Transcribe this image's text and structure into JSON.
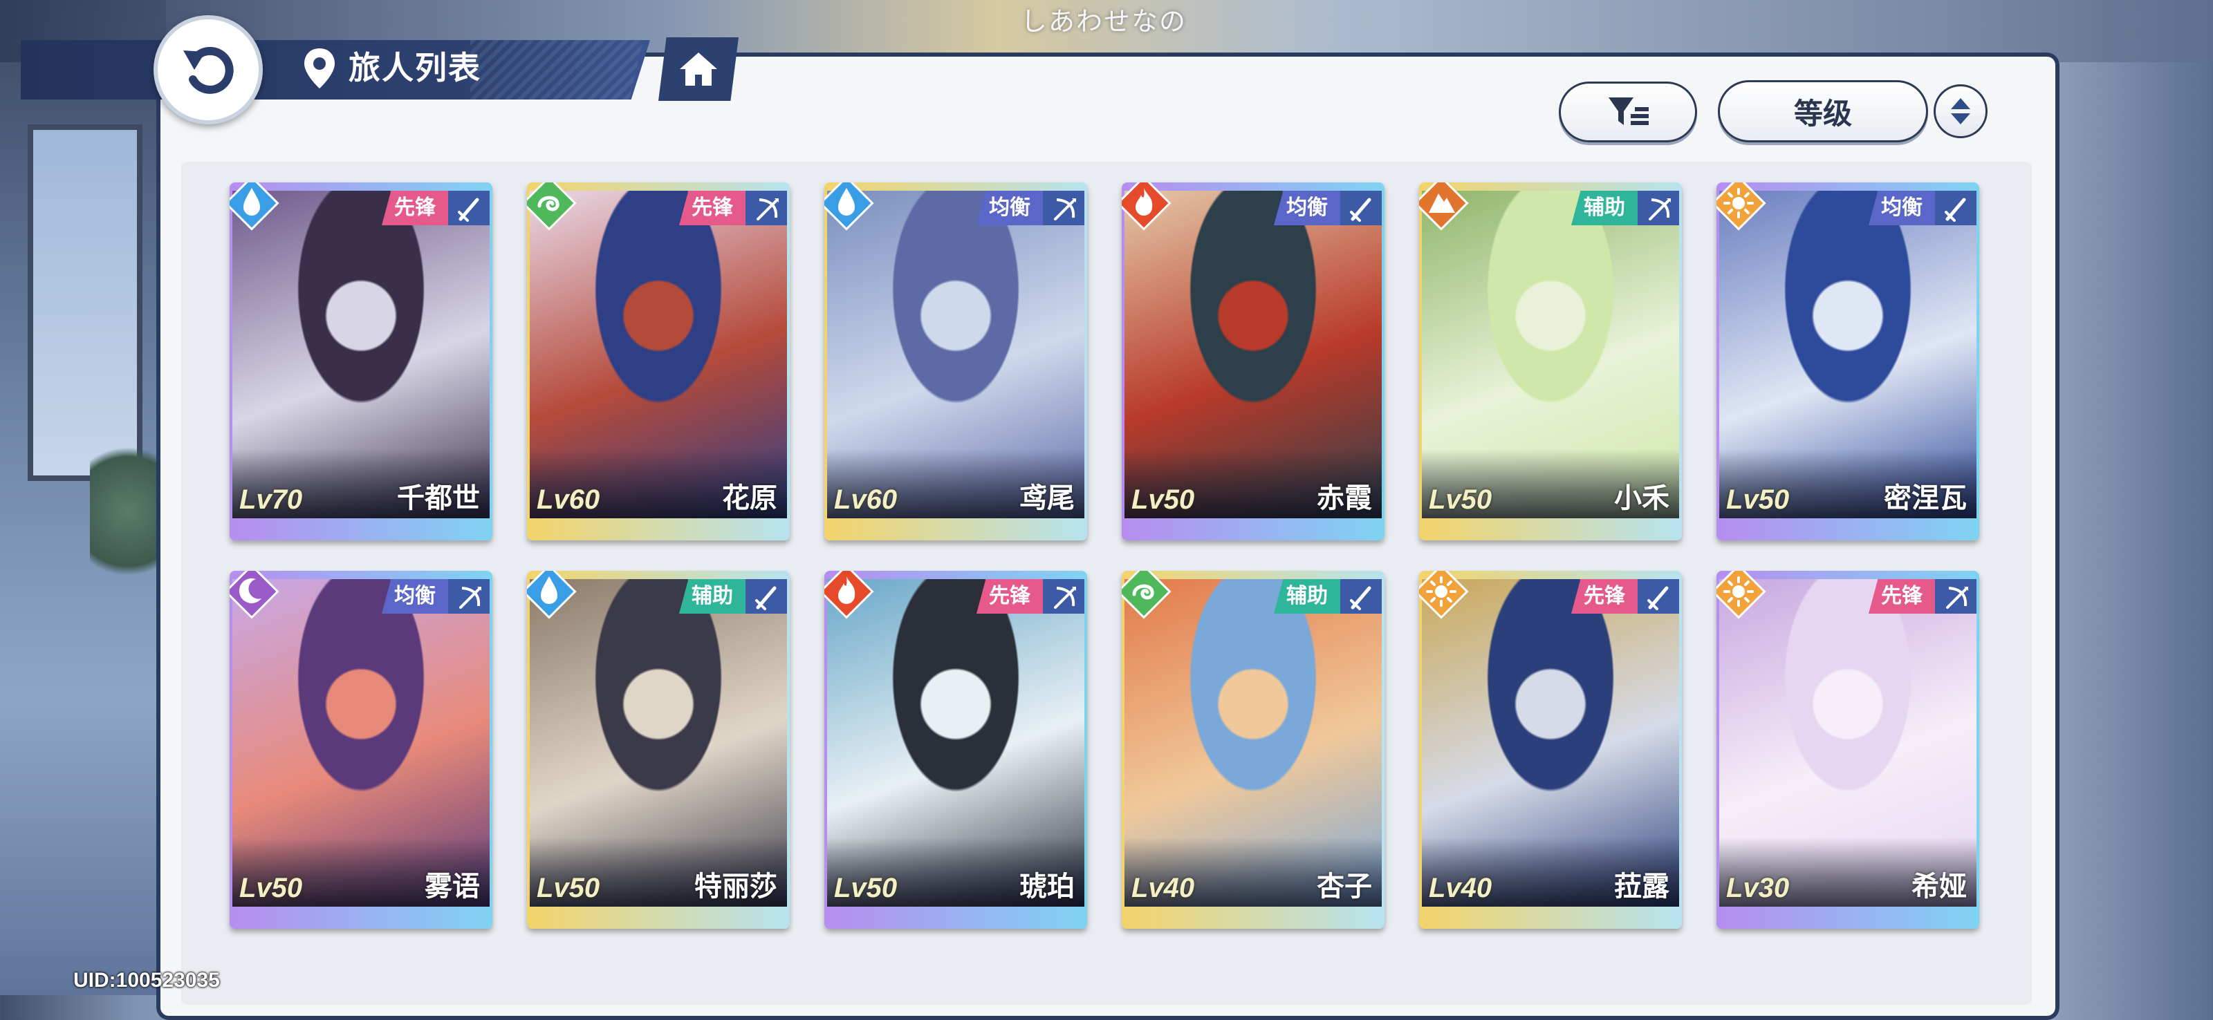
{
  "header": {
    "subtitle": "しあわせなの",
    "title": "旅人列表"
  },
  "toolbar": {
    "sort_label": "等级"
  },
  "footer": {
    "uid": "UID:100523035"
  },
  "colors": {
    "role_vanguard": "#e55a8a",
    "role_balance": "#5b67c8",
    "role_support": "#2fb59a",
    "water": "#3a9ee6",
    "wind": "#4fb85a",
    "fire": "#e54a2a",
    "earth": "#e2752e",
    "light": "#f2a23a",
    "dark": "#9a5bc8"
  },
  "cards": [
    {
      "level": "Lv70",
      "name": "千都世",
      "role": "先锋",
      "element": "water-drop-icon",
      "class": "sword-icon"
    },
    {
      "level": "Lv60",
      "name": "花原",
      "role": "先锋",
      "element": "wind-swirl-icon",
      "class": "bow-icon"
    },
    {
      "level": "Lv60",
      "name": "鸢尾",
      "role": "均衡",
      "element": "water-drop-icon",
      "class": "bow-icon"
    },
    {
      "level": "Lv50",
      "name": "赤霞",
      "role": "均衡",
      "element": "fire-flame-icon",
      "class": "sword-icon"
    },
    {
      "level": "Lv50",
      "name": "小禾",
      "role": "辅助",
      "element": "earth-mountain-icon",
      "class": "bow-icon"
    },
    {
      "level": "Lv50",
      "name": "密涅瓦",
      "role": "均衡",
      "element": "light-sun-icon",
      "class": "sword-icon"
    },
    {
      "level": "Lv50",
      "name": "雾语",
      "role": "均衡",
      "element": "dark-moon-icon",
      "class": "bow-icon"
    },
    {
      "level": "Lv50",
      "name": "特丽莎",
      "role": "辅助",
      "element": "water-drop-icon",
      "class": "sword-icon"
    },
    {
      "level": "Lv50",
      "name": "琥珀",
      "role": "先锋",
      "element": "fire-flame-icon",
      "class": "bow-icon"
    },
    {
      "level": "Lv40",
      "name": "杏子",
      "role": "辅助",
      "element": "wind-swirl-icon",
      "class": "sword-icon"
    },
    {
      "level": "Lv40",
      "name": "菈露",
      "role": "先锋",
      "element": "light-sun-icon",
      "class": "sword-icon"
    },
    {
      "level": "Lv30",
      "name": "希娅",
      "role": "先锋",
      "element": "light-sun-icon",
      "class": "bow-icon"
    }
  ]
}
